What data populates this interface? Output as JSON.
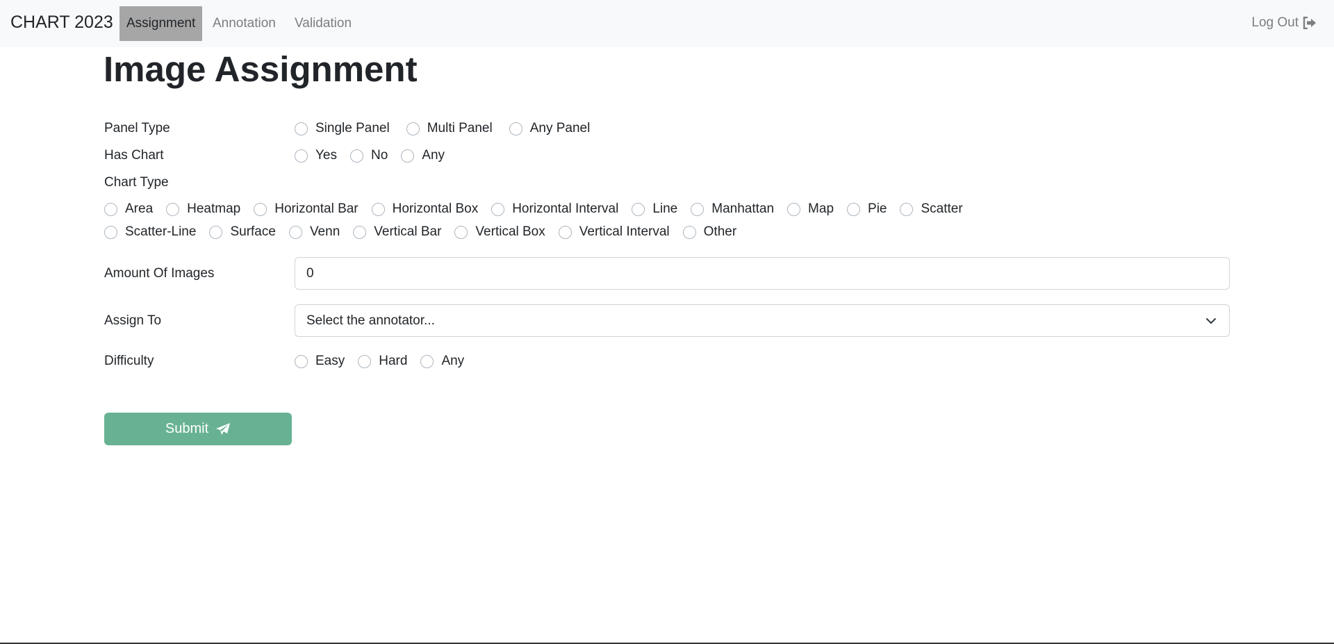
{
  "nav": {
    "brand": "CHART 2023",
    "links": [
      "Assignment",
      "Annotation",
      "Validation"
    ],
    "logout": "Log Out"
  },
  "page": {
    "title": "Image Assignment"
  },
  "form": {
    "panel_type": {
      "label": "Panel Type",
      "options": [
        "Single Panel",
        "Multi Panel",
        "Any Panel"
      ]
    },
    "has_chart": {
      "label": "Has Chart",
      "options": [
        "Yes",
        "No",
        "Any"
      ]
    },
    "chart_type": {
      "label": "Chart Type",
      "row1": [
        "Area",
        "Heatmap",
        "Horizontal Bar",
        "Horizontal Box",
        "Horizontal Interval",
        "Line",
        "Manhattan",
        "Map",
        "Pie",
        "Scatter"
      ],
      "row2": [
        "Scatter-Line",
        "Surface",
        "Venn",
        "Vertical Bar",
        "Vertical Box",
        "Vertical Interval",
        "Other"
      ]
    },
    "amount": {
      "label": "Amount Of Images",
      "value": "0"
    },
    "assign_to": {
      "label": "Assign To",
      "placeholder": "Select the annotator..."
    },
    "difficulty": {
      "label": "Difficulty",
      "options": [
        "Easy",
        "Hard",
        "Any"
      ]
    },
    "submit_label": "Submit"
  }
}
